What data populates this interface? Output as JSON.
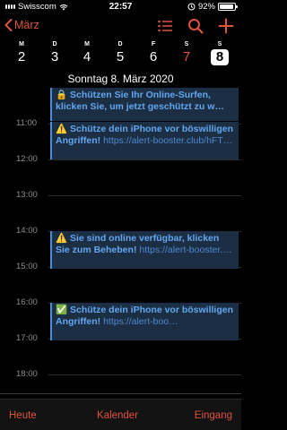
{
  "status": {
    "carrier": "Swisscom",
    "time": "22:57",
    "battery": "92%",
    "battery_fraction": 0.92
  },
  "nav": {
    "back_label": "März",
    "icons": [
      "list-icon",
      "search-icon",
      "add-icon"
    ]
  },
  "week": {
    "days": [
      {
        "letter": "M",
        "num": "2"
      },
      {
        "letter": "D",
        "num": "3"
      },
      {
        "letter": "M",
        "num": "4"
      },
      {
        "letter": "D",
        "num": "5"
      },
      {
        "letter": "F",
        "num": "6"
      },
      {
        "letter": "S",
        "num": "7"
      },
      {
        "letter": "S",
        "num": "8"
      }
    ]
  },
  "date_label": "Sonntag  8. März 2020",
  "hours": [
    "11:00",
    "12:00",
    "13:00",
    "14:00",
    "15:00",
    "16:00",
    "17:00",
    "18:00"
  ],
  "events": [
    {
      "title": "🔒 Schützen Sie Ihr Online-Surfen, klicken Sie, um jetzt geschützt zu w…",
      "url": ""
    },
    {
      "title": "⚠️ Schütze dein iPhone vor böswilligen Angriffen!",
      "url": "https://alert-booster.club/hFT…"
    },
    {
      "title": "⚠️ Sie sind online verfügbar, klicken Sie zum Beheben!",
      "url": "https://alert-booster.…"
    },
    {
      "title": "✅ Schütze dein iPhone vor böswilligen Angriffen!",
      "url": "https://alert-boo…"
    }
  ],
  "tabs": {
    "today": "Heute",
    "calendars": "Kalender",
    "inbox": "Eingang"
  },
  "colors": {
    "accent": "#e0533d",
    "event_bg": "#1c2e44",
    "event_text": "#62a7ef"
  }
}
